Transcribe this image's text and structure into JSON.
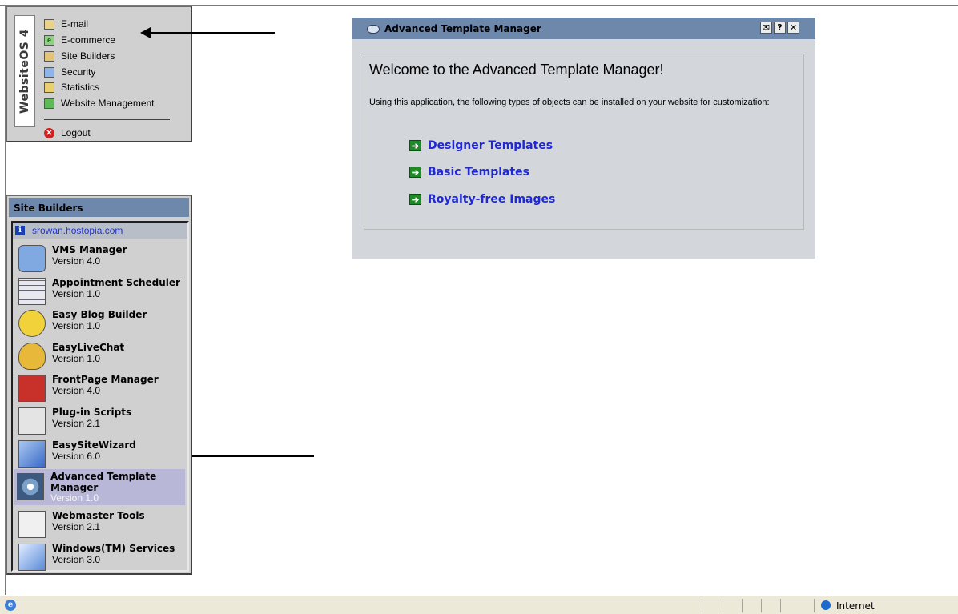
{
  "menu": {
    "logo": "WebsiteOS 4",
    "items": [
      {
        "label": "E-mail",
        "icon": "email-icon",
        "color": "#c8a040"
      },
      {
        "label": "E-commerce",
        "icon": "ecommerce-icon",
        "color": "#3e9a35"
      },
      {
        "label": "Site Builders",
        "icon": "site-builders-icon",
        "color": "#c8a040"
      },
      {
        "label": "Security",
        "icon": "security-icon",
        "color": "#3a6ac9"
      },
      {
        "label": "Statistics",
        "icon": "statistics-icon",
        "color": "#c8a040"
      },
      {
        "label": "Website Management",
        "icon": "website-management-icon",
        "color": "#2a8a30"
      }
    ],
    "logout": "Logout"
  },
  "site_builders": {
    "title": "Site Builders",
    "domain": "srowan.hostopia.com",
    "apps": [
      {
        "name": "VMS Manager",
        "version": "Version 4.0",
        "icon": "vms-manager-icon",
        "color": "#4a7fc8"
      },
      {
        "name": "Appointment Scheduler",
        "version": "Version 1.0",
        "icon": "calendar-icon",
        "color": "#e8e8f4"
      },
      {
        "name": "Easy Blog Builder",
        "version": "Version 1.0",
        "icon": "blog-builder-icon",
        "color": "#f2d23a"
      },
      {
        "name": "EasyLiveChat",
        "version": "Version 1.0",
        "icon": "live-chat-icon",
        "color": "#e8b83a"
      },
      {
        "name": "FrontPage Manager",
        "version": "Version 4.0",
        "icon": "frontpage-icon",
        "color": "#c8302a"
      },
      {
        "name": "Plug-in Scripts",
        "version": "Version 2.1",
        "icon": "scripts-icon",
        "color": "#e4e4e4"
      },
      {
        "name": "EasySiteWizard",
        "version": "Version 6.0",
        "icon": "site-wizard-icon",
        "color": "#3a6ac9"
      },
      {
        "name": "Advanced Template Manager",
        "version": "Version 1.0",
        "icon": "template-manager-icon",
        "color": "#6c88a8",
        "selected": true
      },
      {
        "name": "Webmaster Tools",
        "version": "Version 2.1",
        "icon": "webmaster-tools-icon",
        "color": "#f0f0f0"
      },
      {
        "name": "Windows(TM) Services",
        "version": "Version 3.0",
        "icon": "windows-services-icon",
        "color": "#5a8ad8"
      }
    ]
  },
  "dialog": {
    "title": "Advanced Template Manager",
    "buttons": [
      "✉",
      "?",
      "✕"
    ],
    "heading": "Welcome to the Advanced Template Manager!",
    "intro": "Using this application, the following types of objects can be installed on your website for customization:",
    "options": [
      "Designer Templates",
      "Basic Templates",
      "Royalty-free Images"
    ]
  },
  "status_bar": {
    "zone": "Internet"
  }
}
